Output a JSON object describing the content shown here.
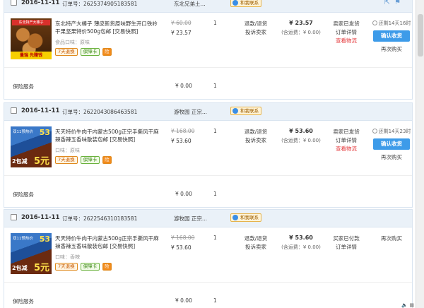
{
  "orders": [
    {
      "date": "2016-11-11",
      "order_no_label": "订单号：2625374905183581",
      "shop": "东北兄弟土...",
      "contact": "和我联系",
      "item": {
        "thumb_top": "东北特产大榛子",
        "thumb_tag": "量瑞 先赚钱",
        "title": "东北特产大榛子 薄皮新货原味野生开口铁岭干果坚果特价500g包邮 [交易快照]",
        "attr": "食品口味：原味",
        "badges": [
          "7天退换",
          "保障卡",
          "险"
        ],
        "price_orig": "¥ 60.00",
        "price_now": "¥ 23.57",
        "qty": "1",
        "after_sale": [
          "退款/退货",
          "投诉卖家"
        ],
        "total": "¥ 23.57",
        "shipping": "(含运费：¥ 0.00)",
        "status": [
          "卖家已发货",
          "订单详情",
          "查看物流"
        ],
        "remain": "还剩14天16时",
        "confirm": "确认收货",
        "rebuy": "再次购买"
      },
      "insurance": {
        "label": "保险服务",
        "price": "¥ 0.00",
        "qty": "1"
      }
    },
    {
      "date": "2016-11-11",
      "order_no_label": "订单号：2622043086463581",
      "shop": "游牧园 正宗...",
      "contact": "和我联系",
      "item": {
        "thumb_t1": "双11预热价",
        "thumb_badge": "53",
        "thumb_t2": "2包减",
        "thumb_t3": "5元",
        "title": "天天特价牛肉干内蒙古500g正宗手撕风干麻辣香辣五香味散装包邮 [交易快照]",
        "attr": "口味：原味",
        "badges": [
          "7天退换",
          "保障卡",
          "险"
        ],
        "price_orig": "¥ 168.00",
        "price_now": "¥ 53.60",
        "qty": "1",
        "after_sale": [
          "退款/退货",
          "投诉卖家"
        ],
        "total": "¥ 53.60",
        "shipping": "(含运费：¥ 0.00)",
        "status": [
          "卖家已发货",
          "订单详情",
          "查看物流"
        ],
        "remain": "还剩14天23时",
        "confirm": "确认收货",
        "rebuy": "再次购买"
      },
      "insurance": {
        "label": "保险服务",
        "price": "¥ 0.00",
        "qty": "1"
      }
    },
    {
      "date": "2016-11-11",
      "order_no_label": "订单号：2622546310183581",
      "shop": "游牧园 正宗...",
      "contact": "和我联系",
      "item": {
        "thumb_t1": "双11预热价",
        "thumb_badge": "53",
        "thumb_t2": "2包减",
        "thumb_t3": "5元",
        "title": "天天特价牛肉干内蒙古500g正宗手撕风干麻辣香辣五香味散装包邮 [交易快照]",
        "attr": "口味：香辣",
        "badges": [
          "7天退换",
          "保障卡",
          "险"
        ],
        "price_orig": "¥ 168.00",
        "price_now": "¥ 53.60",
        "qty": "1",
        "after_sale": [
          "退款/退货",
          "投诉卖家"
        ],
        "total": "¥ 53.60",
        "shipping": "(含运费：¥ 0.00)",
        "status": [
          "买家已付款",
          "订单详情"
        ],
        "remain": "",
        "confirm": "",
        "rebuy": "再次购买"
      },
      "insurance": {
        "label": "保险服务",
        "price": "¥ 0.00",
        "qty": "1"
      }
    }
  ],
  "colors": {
    "header_bg": "#eaf1f8",
    "confirm_button": "#3d9be9",
    "logistics_link": "#e4393c"
  },
  "icons": {
    "share": "share-icon",
    "flag": "flag-icon"
  }
}
